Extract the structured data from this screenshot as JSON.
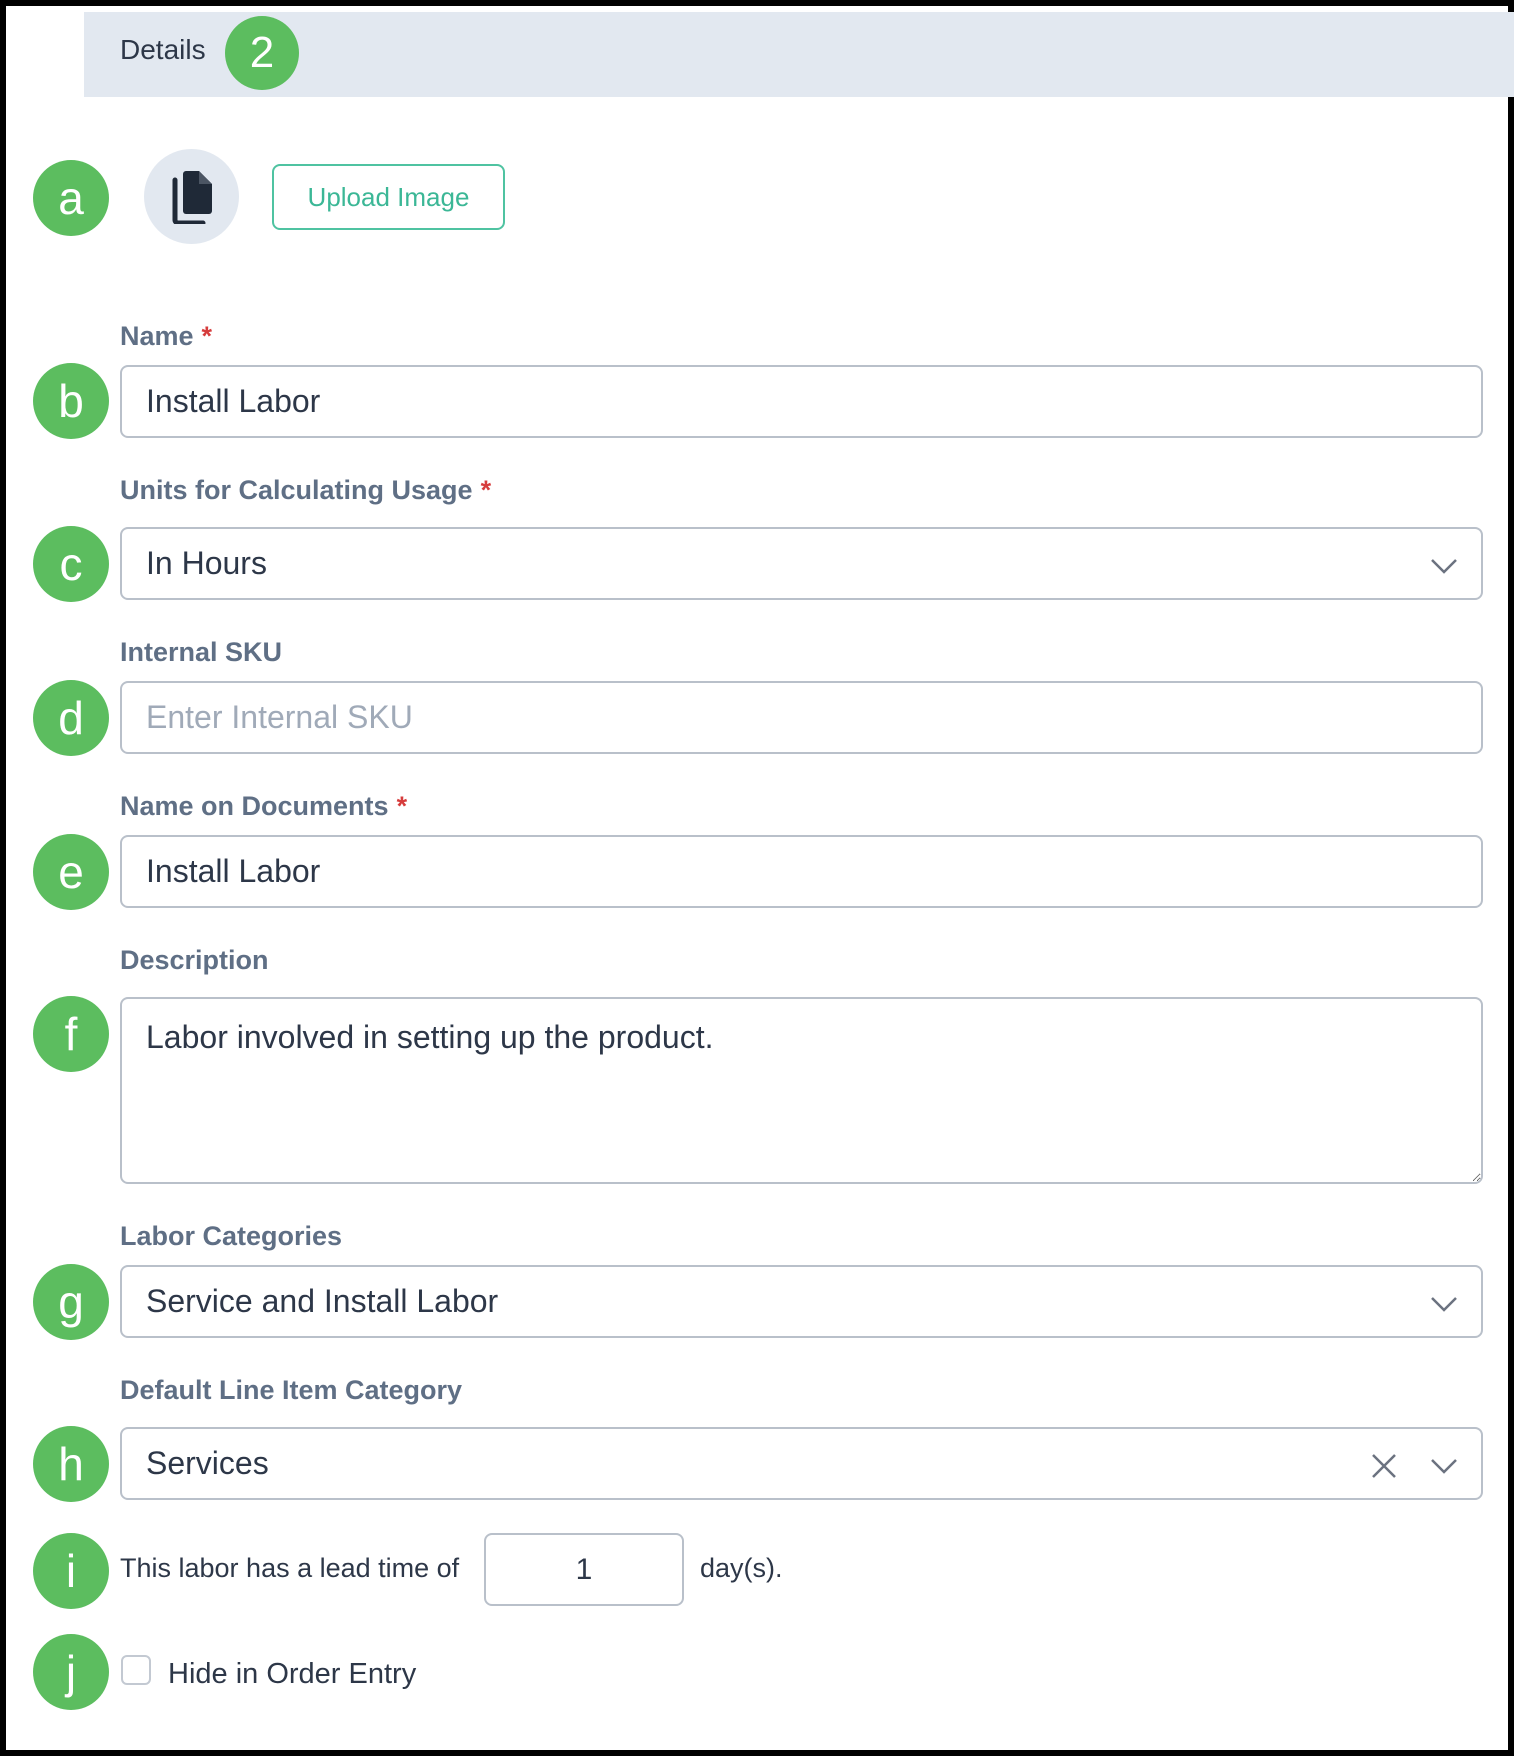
{
  "header": {
    "title": "Details",
    "step_badge": "2"
  },
  "badges": {
    "a": "a",
    "b": "b",
    "c": "c",
    "d": "d",
    "e": "e",
    "f": "f",
    "g": "g",
    "h": "h",
    "i": "i",
    "j": "j"
  },
  "image_section": {
    "icon": "copy-document-icon",
    "upload_label": "Upload Image"
  },
  "fields": {
    "name": {
      "label": "Name",
      "required_mark": "*",
      "value": "Install Labor"
    },
    "units": {
      "label": "Units for Calculating Usage",
      "required_mark": "*",
      "value": "In Hours"
    },
    "sku": {
      "label": "Internal SKU",
      "placeholder": "Enter Internal SKU",
      "value": ""
    },
    "name_on_documents": {
      "label": "Name on Documents",
      "required_mark": "*",
      "value": "Install Labor"
    },
    "description": {
      "label": "Description",
      "value": "Labor involved in setting up the product."
    },
    "labor_categories": {
      "label": "Labor Categories",
      "value": "Service and Install Labor"
    },
    "default_line_item_category": {
      "label": "Default Line Item Category",
      "value": "Services"
    }
  },
  "lead_time": {
    "prefix": "This labor has a lead time of",
    "value": "1",
    "suffix": "day(s)."
  },
  "hide_in_order_entry": {
    "label": "Hide in Order Entry",
    "checked": false
  },
  "colors": {
    "badge_green": "#5cbd5f",
    "accent_teal": "#3bb796",
    "required_red": "#d63c3c",
    "header_gray": "#e2e8f0"
  }
}
